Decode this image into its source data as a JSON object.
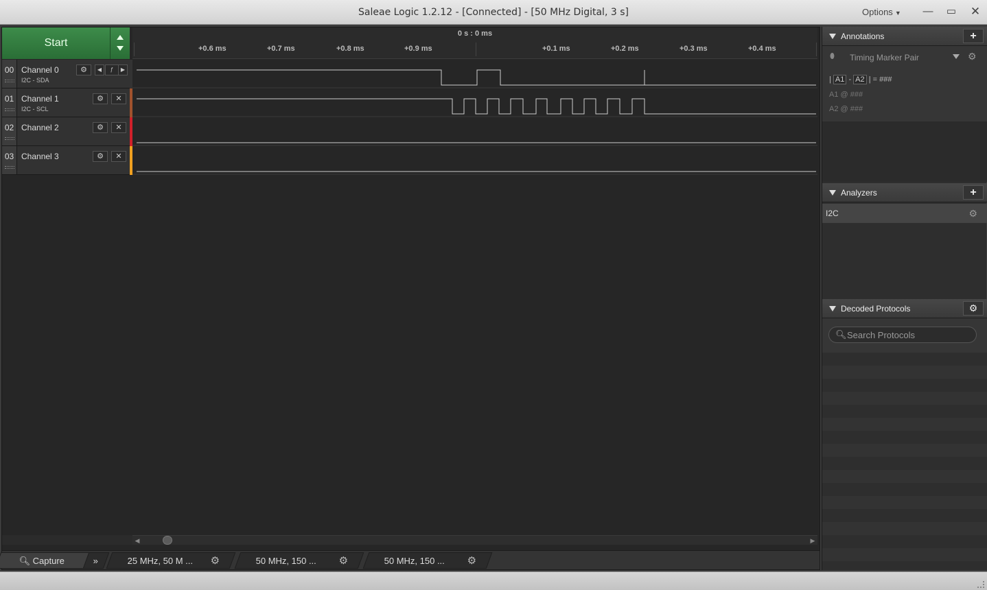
{
  "window": {
    "title": "Saleae Logic 1.2.12 - [Connected] - [50 MHz Digital, 3 s]",
    "options_label": "Options",
    "minimize": "—",
    "maximize": "▭",
    "close": "✕"
  },
  "controls": {
    "start_label": "Start"
  },
  "timeline": {
    "center_label": "0 s : 0 ms",
    "ticks": [
      "+0.6 ms",
      "+0.7 ms",
      "+0.8 ms",
      "+0.9 ms",
      "+0.1 ms",
      "+0.2 ms",
      "+0.3 ms",
      "+0.4 ms"
    ]
  },
  "channels": [
    {
      "num": "00",
      "name": "Channel 0",
      "sub": "I2C - SDA",
      "color": "#333333"
    },
    {
      "num": "01",
      "name": "Channel 1",
      "sub": "I2C - SCL",
      "color": "#a0522d"
    },
    {
      "num": "02",
      "name": "Channel 2",
      "sub": "",
      "color": "#d0202a"
    },
    {
      "num": "03",
      "name": "Channel 3",
      "sub": "",
      "color": "#f0a020"
    }
  ],
  "tabs": {
    "capture": "Capture",
    "more": "»",
    "items": [
      "25 MHz, 50 M ...",
      "50 MHz, 150 ...",
      "50 MHz, 150 ..."
    ]
  },
  "annotations": {
    "title": "Annotations",
    "add": "+",
    "marker_name": "Timing Marker Pair",
    "line1_a1": "A1",
    "line1_a2": "A2",
    "line1_value": "= ###",
    "line2": "A1  @  ###",
    "line3": "A2  @  ###"
  },
  "analyzers": {
    "title": "Analyzers",
    "add": "+",
    "items": [
      "I2C"
    ]
  },
  "decoded": {
    "title": "Decoded Protocols",
    "search_placeholder": "Search Protocols"
  }
}
